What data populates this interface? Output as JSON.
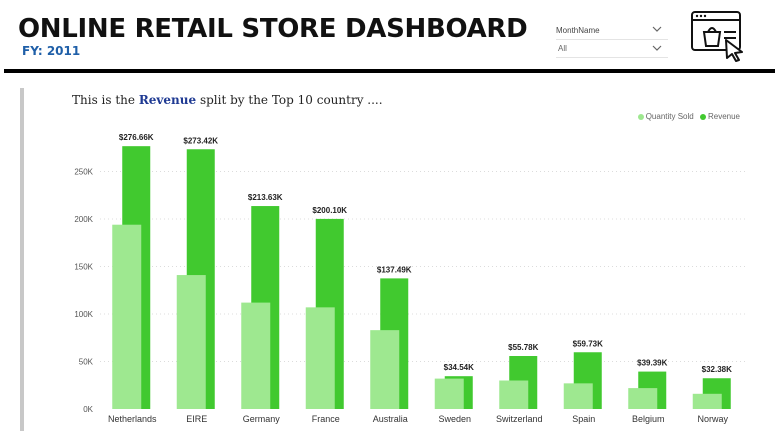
{
  "header": {
    "title": "ONLINE RETAIL STORE DASHBOARD",
    "subtitle": "FY: 2011"
  },
  "slicer": {
    "label": "MonthName",
    "value": "All"
  },
  "icons": {
    "store": "online-store-cart-icon",
    "dropdown": "chevron-down-icon"
  },
  "chart_heading": {
    "prefix": "This is the ",
    "emphasis": "Revenue",
    "suffix": " split by the Top 10 country ...."
  },
  "colors": {
    "quantity": "#9ee890",
    "revenue": "#41c92f",
    "accent": "#1f3a93",
    "subtitle": "#1f5fa8"
  },
  "chart_data": {
    "type": "bar",
    "categories": [
      "Netherlands",
      "EIRE",
      "Germany",
      "France",
      "Australia",
      "Sweden",
      "Switzerland",
      "Spain",
      "Belgium",
      "Norway"
    ],
    "series": [
      {
        "name": "Quantity Sold",
        "values": [
          194000,
          141000,
          112000,
          107000,
          83000,
          32000,
          30000,
          27000,
          22000,
          16000
        ]
      },
      {
        "name": "Revenue",
        "values": [
          276660,
          273420,
          213630,
          200100,
          137490,
          34540,
          55780,
          59730,
          39390,
          32380
        ]
      }
    ],
    "data_labels": [
      "$276.66K",
      "$273.42K",
      "$213.63K",
      "$200.10K",
      "$137.49K",
      "$34.54K",
      "$55.78K",
      "$59.73K",
      "$39.39K",
      "$32.38K"
    ],
    "y_ticks": [
      "0K",
      "50K",
      "100K",
      "150K",
      "200K",
      "250K"
    ],
    "ylim": [
      0,
      290000
    ],
    "grid": true,
    "legend": "top-right"
  }
}
